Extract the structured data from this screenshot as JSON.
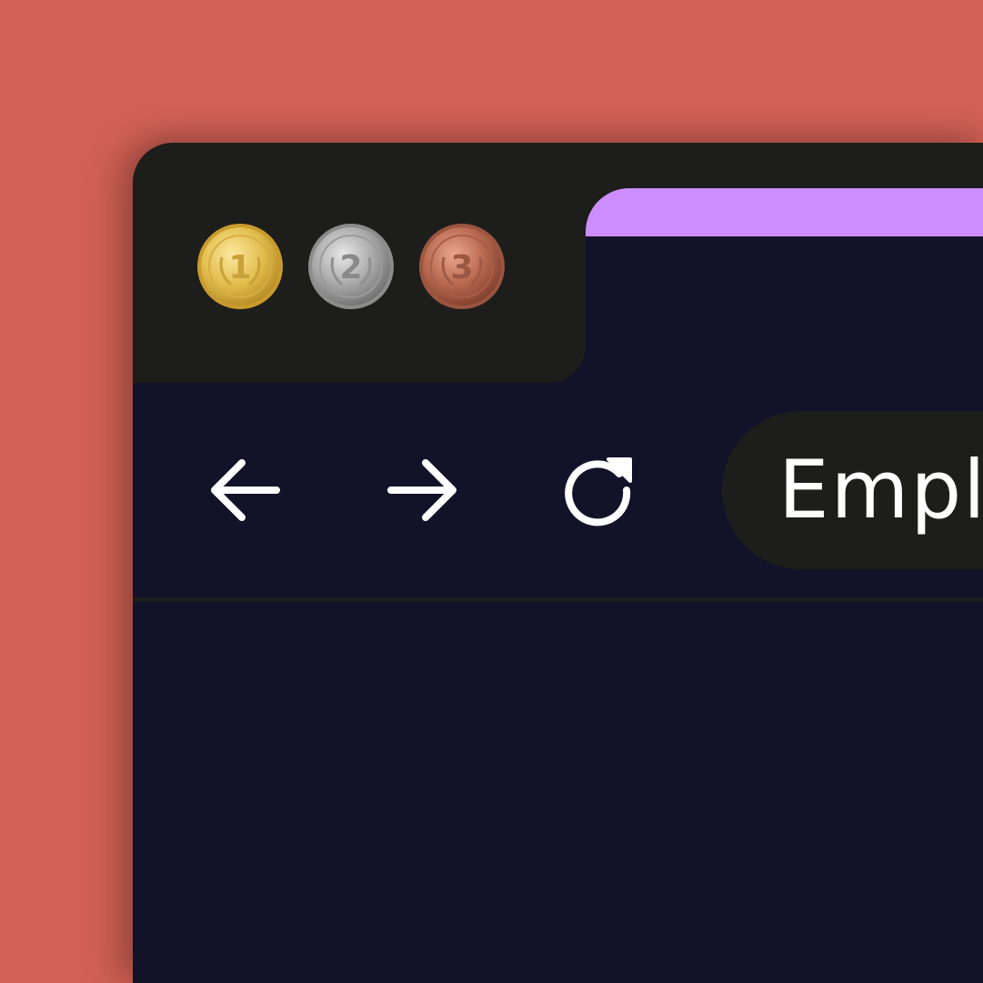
{
  "window": {
    "medals": [
      {
        "icon": "gold-medal-1-icon",
        "number": "1",
        "color": "#E8C14E"
      },
      {
        "icon": "silver-medal-2-icon",
        "number": "2",
        "color": "#A9A9A9"
      },
      {
        "icon": "bronze-medal-3-icon",
        "number": "3",
        "color": "#B8684F"
      }
    ],
    "tab": {
      "color": "#CC8EFE"
    }
  },
  "toolbar": {
    "back_icon": "arrow-left-icon",
    "forward_icon": "arrow-right-icon",
    "reload_icon": "reload-icon",
    "address_text": "Empl"
  },
  "colors": {
    "background": "#D26155",
    "chrome": "#1D1D1B",
    "content": "#121228",
    "accent": "#CC8EFE"
  }
}
